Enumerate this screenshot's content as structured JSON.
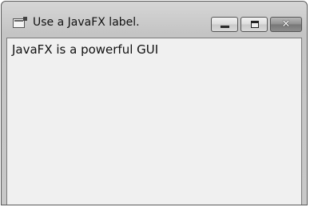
{
  "window": {
    "title": "Use a JavaFX label.",
    "icon": "java-app-icon"
  },
  "caption_buttons": {
    "minimize": "minimize-icon",
    "maximize": "maximize-icon",
    "close": "close-icon",
    "close_glyph": "✕"
  },
  "content": {
    "label_text": "JavaFX is a powerful GUI"
  }
}
